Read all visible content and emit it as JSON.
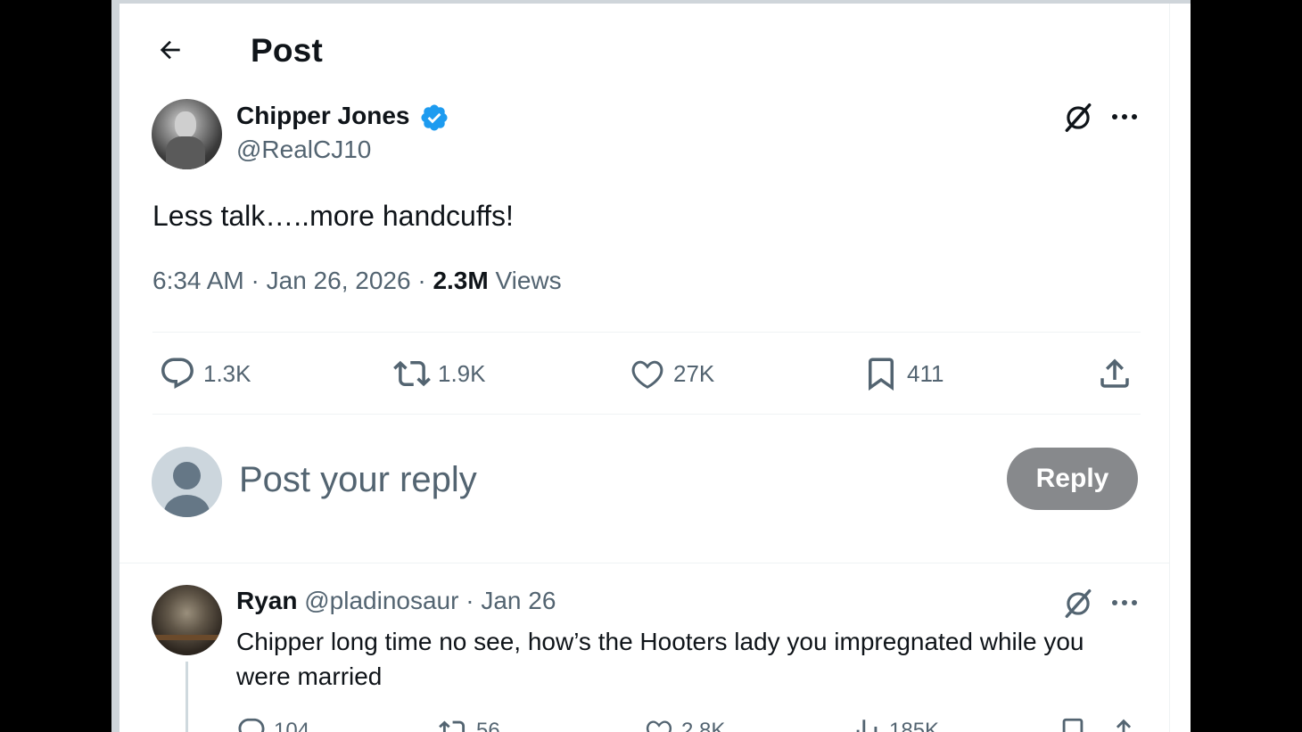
{
  "header": {
    "title": "Post",
    "back_icon": "arrow-left-icon"
  },
  "post": {
    "author_name": "Chipper Jones",
    "author_handle": "@RealCJ10",
    "verified": true,
    "text": "Less talk…..more handcuffs!",
    "time": "6:34 AM",
    "date": "Jan 26, 2026",
    "views_count": "2.3M",
    "views_label": "Views",
    "actions": {
      "replies": "1.3K",
      "reposts": "1.9K",
      "likes": "27K",
      "bookmarks": "411"
    }
  },
  "composer": {
    "placeholder": "Post your reply",
    "button_label": "Reply"
  },
  "replies": [
    {
      "name": "Ryan",
      "handle": "@pladinosaur",
      "separator": "·",
      "date": "Jan 26",
      "text": "Chipper long time no see, how’s the Hooters lady you impregnated while you were married",
      "actions": {
        "replies": "104",
        "reposts": "56",
        "likes": "2.8K",
        "views": "185K"
      }
    }
  ],
  "colors": {
    "accent": "#1d9bf0",
    "text_primary": "#0f1419",
    "text_secondary": "#536471",
    "reply_button_bg": "#87898c"
  }
}
